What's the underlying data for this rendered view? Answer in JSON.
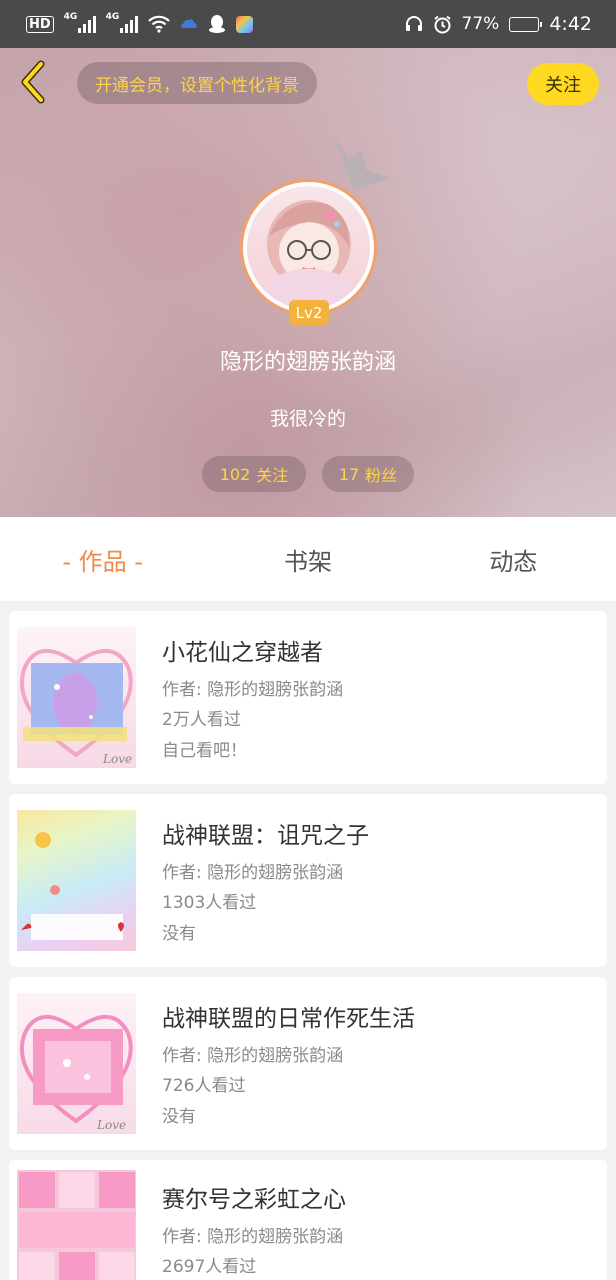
{
  "status_bar": {
    "hd": "HD",
    "net1": "4G",
    "net2": "4G",
    "battery_percent": "77%",
    "battery_level": 0.77,
    "time": "4:42"
  },
  "header": {
    "vip_banner": "开通会员，设置个性化背景",
    "follow_label": "关注",
    "level": "Lv2",
    "username": "隐形的翅膀张韵涵",
    "bio": "我很冷的",
    "following_count": "102",
    "following_label": "关注",
    "fans_count": "17",
    "fans_label": "粉丝"
  },
  "tabs": {
    "works": "- 作品 -",
    "bookshelf": "书架",
    "activity": "动态"
  },
  "works": [
    {
      "title": "小花仙之穿越者",
      "author": "作者: 隐形的翅膀张韵涵",
      "views": "2万人看过",
      "summary": "自己看吧！"
    },
    {
      "title": "战神联盟：诅咒之子",
      "author": "作者: 隐形的翅膀张韵涵",
      "views": "1303人看过",
      "summary": "没有"
    },
    {
      "title": "战神联盟的日常作死生活",
      "author": "作者: 隐形的翅膀张韵涵",
      "views": "726人看过",
      "summary": "没有"
    },
    {
      "title": "赛尔号之彩虹之心",
      "author": "作者: 隐形的翅膀张韵涵",
      "views": "2697人看过",
      "summary": ""
    }
  ],
  "colors": {
    "accent": "#f08a4b",
    "follow_button": "#ffd822",
    "pill_text": "#ffd34a",
    "level_badge": "#f2b23c"
  }
}
